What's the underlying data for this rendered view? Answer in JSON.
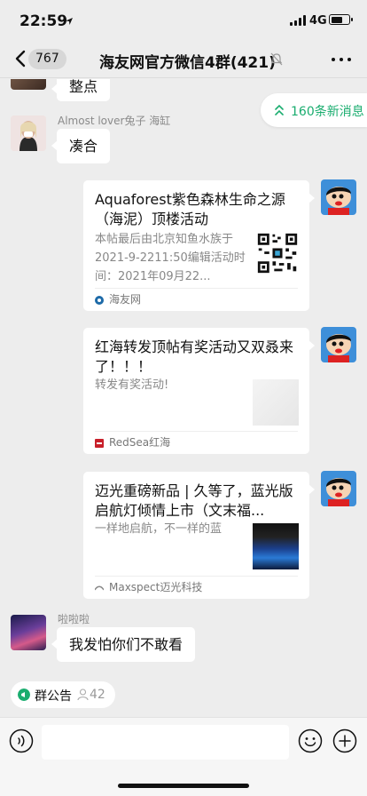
{
  "status_bar": {
    "time": "22:59",
    "network": "4G"
  },
  "nav": {
    "back_count": "767",
    "title": "海友网官方微信4群(421)"
  },
  "new_messages": {
    "label": "160条新消息"
  },
  "messages": [
    {
      "type": "text",
      "side": "left",
      "text": "整点"
    },
    {
      "type": "text",
      "side": "left",
      "sender": "Almost lover兔子 海缸",
      "text": "凑合"
    },
    {
      "type": "link",
      "side": "right",
      "title": "Aquaforest紫色森林生命之源（海泥）顶楼活动",
      "description": "本帖最后由北京知鱼水族于2021-9-2211:50编辑活动时间：2021年09月22...",
      "source": "海友网",
      "thumbnail": "qr-code"
    },
    {
      "type": "link",
      "side": "right",
      "title": "红海转发顶帖有奖活动又双叒来了！！！",
      "description": "转发有奖活动!",
      "source": "RedSea红海",
      "thumbnail": "photo"
    },
    {
      "type": "link",
      "side": "right",
      "title": "迈光重磅新品 | 久等了，蓝光版启航灯倾情上市（文末福...",
      "description": "一样地启航，不一样的蓝",
      "source": "Maxspect迈光科技",
      "thumbnail": "aquarium-photo"
    },
    {
      "type": "text",
      "side": "left",
      "sender": "啦啦啦",
      "text": "我发怕你们不敢看"
    }
  ],
  "notice": {
    "label": "群公告",
    "count": "42"
  },
  "input": {
    "placeholder": ""
  },
  "colors": {
    "accent": "#1aad6f",
    "background": "#ededed",
    "bubble": "#ffffff"
  }
}
